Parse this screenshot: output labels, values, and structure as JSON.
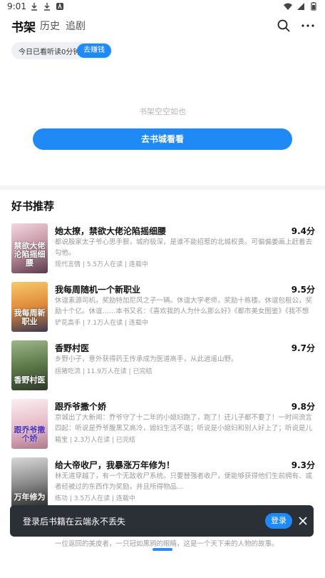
{
  "status": {
    "time": "9:01"
  },
  "nav": {
    "tabs": [
      {
        "label": "书架",
        "active": true
      },
      {
        "label": "历史",
        "active": false
      },
      {
        "label": "追剧",
        "active": false
      }
    ]
  },
  "reading": {
    "summary": "今日已看听读0分钟",
    "earn_label": "去赚钱"
  },
  "shelf": {
    "empty_text": "书架空空如也",
    "go_store_label": "去书城看看"
  },
  "recommend": {
    "title": "好书推荐",
    "books": [
      {
        "title": "她太撩，禁欲大佬沦陷摇细腰",
        "score": "9.4分",
        "cover_text": "禁欲大佬沦陷摇细腰",
        "desc": "都说殷家太子爷心思手狠，城府极深，是谁不能招惹的北城权贵。可偏偏姜画上赶着去勾他。",
        "meta": "现代言情 | 5.5万人在读 | 连载中"
      },
      {
        "title": "我每周随机一个新职业",
        "score": "9.5分",
        "cover_text": "我每周新职业",
        "desc": "休谊素源司机，奖励特加尼风之子一辆。休谊大学老师，奖励十栋楼。休谊包租公，奖励十个亿。休谊……本书又名：《喜欢我的人为什么那么好》《都市美女图鉴》《我不想再…",
        "meta": "铲花高手 | 7.1万人在读 | 连载中"
      },
      {
        "title": "香野村医",
        "score": "9.7分",
        "cover_text": "香野村医",
        "desc": "乡野小子，意外获得药王传承成为医道高手，从此逍遥山野。",
        "meta": "拐猪吃流 | 11.9万人在读 | 已完结"
      },
      {
        "title": "跟乔爷撒个娇",
        "score": "9.8分",
        "cover_text": "跟乔爷撒个娇",
        "desc": "京城出了大新闻：乔爷守了十二年的小媳妇跑了，跑了！还儿子都不要了！一时间流言四起：听说是乔爷腹黑又高冷，媳妇生活不谐；听说是小媳妇和别人好上了；听说是儿子…",
        "meta": "箱宝 | 2.3万人在读 | 已完结"
      },
      {
        "title": "给大帝收尸，我暴涨万年修为！",
        "score": "9.3分",
        "cover_text": "万年修为",
        "desc": "林无道穿越了，有一个无敌收尸系统。只要替强者收尸，便能够获得他们生前拥有、或者经被过的东西作为奖励，并且所得物品…",
        "meta": "练功 | 3.5万人在读 | 连载中"
      }
    ]
  },
  "toast": {
    "text": "登录后书籍在云端永不丢失",
    "button": "登录"
  },
  "peek_text": "一位返回的美皮者，一只冠如黑鸦的眼睛，这是一个天下来的人物的故事。"
}
